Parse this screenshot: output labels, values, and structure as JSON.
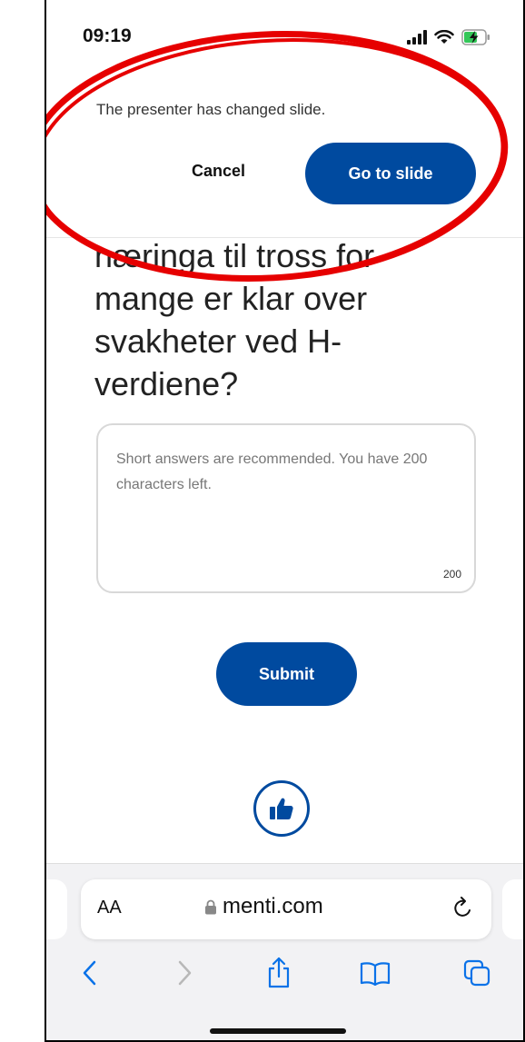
{
  "status_bar": {
    "time": "09:19"
  },
  "notification": {
    "message": "The presenter has changed slide.",
    "cancel_label": "Cancel",
    "goto_label": "Go to slide"
  },
  "question": {
    "text": "næringa til tross for mange er klar over svakheter ved H-verdiene?"
  },
  "answer": {
    "placeholder": "Short answers are recommended. You have 200 characters left.",
    "char_count": "200"
  },
  "submit_label": "Submit",
  "browser": {
    "aa_label": "AA",
    "url": "menti.com"
  },
  "colors": {
    "brand": "#004a9f",
    "annotation": "#e60000"
  },
  "icons": [
    "signal-icon",
    "wifi-icon",
    "battery-charging-icon",
    "thumbs-up-icon",
    "lock-icon",
    "reload-icon",
    "back-icon",
    "forward-icon",
    "share-icon",
    "bookmarks-icon",
    "tabs-icon"
  ]
}
